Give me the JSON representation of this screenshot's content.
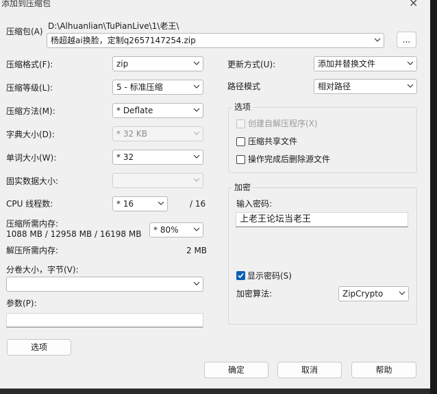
{
  "window": {
    "title": "添加到压缩包",
    "close_glyph": "✕"
  },
  "archive": {
    "label": "压缩包(A)",
    "path": "D:\\Alhuanlian\\TuPianLive\\1\\老王\\",
    "filename": "杨超越ai换脸，定制q2657147254.zip",
    "browse_label": "..."
  },
  "left": {
    "format": {
      "label": "压缩格式(F):",
      "value": "zip"
    },
    "level": {
      "label": "压缩等级(L):",
      "value": "5 - 标准压缩"
    },
    "method": {
      "label": "压缩方法(M):",
      "value": "* Deflate"
    },
    "dict": {
      "label": "字典大小(D):",
      "value": "* 32 KB"
    },
    "word": {
      "label": "单词大小(W):",
      "value": "* 32"
    },
    "solid": {
      "label": "固实数据大小:",
      "value": ""
    },
    "cpu": {
      "label": "CPU 线程数:",
      "value": "* 16",
      "total": "/ 16"
    },
    "mem_compress": {
      "label": "压缩所需内存:",
      "detail": "1088 MB / 12958 MB / 16198 MB",
      "value": "* 80%"
    },
    "mem_decompress": {
      "label": "解压所需内存:",
      "value": "2 MB"
    },
    "volume": {
      "label": "分卷大小，字节(V):",
      "value": ""
    },
    "params": {
      "label": "参数(P):",
      "value": ""
    },
    "options_button": "选项"
  },
  "right": {
    "update": {
      "label": "更新方式(U):",
      "value": "添加并替换文件"
    },
    "path_mode": {
      "label": "路径模式",
      "value": "相对路径"
    },
    "options_group": {
      "title": "选项",
      "sfx": "创建自解压程序(X)",
      "shared": "压缩共享文件",
      "delete": "操作完成后删除源文件"
    },
    "encrypt_group": {
      "title": "加密",
      "password_label": "输入密码:",
      "password_value": "上老王论坛当老王",
      "show_password": "显示密码(S)",
      "method_label": "加密算法:",
      "method_value": "ZipCrypto"
    }
  },
  "buttons": {
    "ok": "确定",
    "cancel": "取消",
    "help": "帮助"
  },
  "colors": {
    "accent": "#0a5fb4"
  }
}
